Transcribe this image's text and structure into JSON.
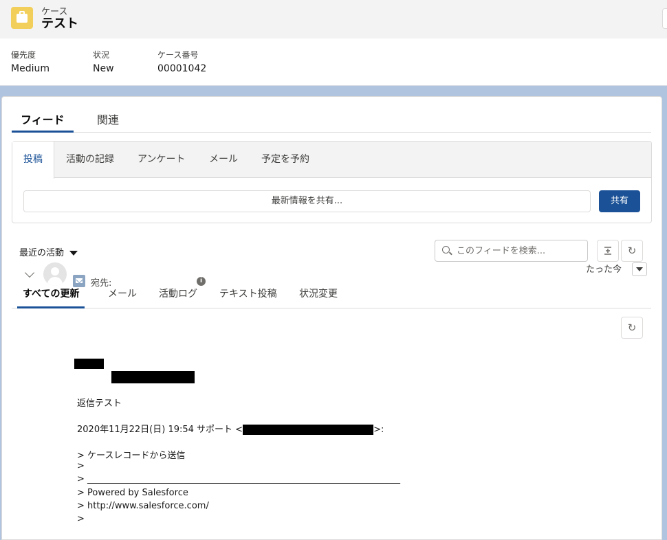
{
  "header": {
    "object_label": "ケース",
    "record_title": "テスト",
    "icon": "case-briefcase-icon",
    "highlights": [
      {
        "label": "優先度",
        "value": "Medium"
      },
      {
        "label": "状況",
        "value": "New"
      },
      {
        "label": "ケース番号",
        "value": "00001042"
      }
    ]
  },
  "main_tabs": [
    "フィード",
    "関連"
  ],
  "publisher": {
    "tabs": [
      "投稿",
      "活動の記録",
      "アンケート",
      "メール",
      "予定を予約"
    ],
    "share_placeholder": "最新情報を共有...",
    "share_button": "共有"
  },
  "feed_controls": {
    "sort_label": "最近の活動",
    "search_placeholder": "このフィードを検索...",
    "filter_tabs": [
      "すべての更新",
      "メール",
      "活動ログ",
      "テキスト投稿",
      "状況変更"
    ]
  },
  "feed_item": {
    "to_label": "宛先:",
    "timestamp": "たった今",
    "body": {
      "line1": "返信テスト",
      "line2_prefix": "2020年11月22日(日) 19:54 サポート <",
      "line2_suffix": ">:",
      "line3": "> ケースレコードから送信",
      "line4": ">",
      "line5": "> ______________________________________________________________________",
      "line6": "> Powered by Salesforce",
      "line7": "> http://www.salesforce.com/",
      "line8": ">"
    }
  },
  "colors": {
    "brand": "#1b5297",
    "case_icon": "#f2cf5b",
    "background": "#b0c4df"
  }
}
